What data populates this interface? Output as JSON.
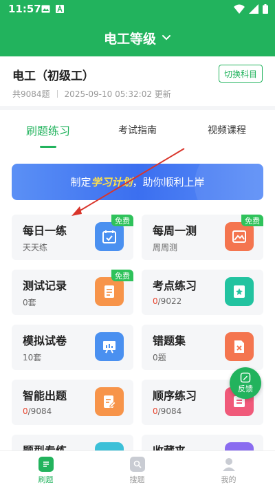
{
  "status_bar": {
    "time": "11:57",
    "icons": [
      "image-icon",
      "text-a-icon",
      "wifi-icon",
      "signal-icon",
      "battery-icon"
    ]
  },
  "header": {
    "title": "电工等级",
    "icon": "chevron-down-icon"
  },
  "subject": {
    "name": "电工（初级工）",
    "count": "共9084题",
    "updated": "2025-09-10 05:32:02 更新",
    "switch_label": "切换科目"
  },
  "tabs": [
    {
      "label": "刷题练习",
      "active": true
    },
    {
      "label": "考试指南"
    },
    {
      "label": "视频课程"
    }
  ],
  "banner": {
    "prefix": "制定",
    "highlight": "学习计划",
    "suffix": "，助你顺利上岸"
  },
  "free_label": "免费",
  "cards": [
    {
      "title": "每日一练",
      "sub": "天天练",
      "icon": "calendar-check-icon",
      "color": "#4a90f0"
    },
    {
      "title": "每周一测",
      "sub": "周周测",
      "icon": "picture-icon",
      "color": "#f4754f"
    },
    {
      "title": "测试记录",
      "sub": "0套",
      "icon": "document-icon",
      "color": "#f7944a"
    },
    {
      "title": "考点练习",
      "done": "0",
      "total": "/9022",
      "icon": "star-badge-icon",
      "color": "#22c3a0"
    },
    {
      "title": "模拟试卷",
      "sub": "10套",
      "icon": "chart-board-icon",
      "color": "#4a90f0"
    },
    {
      "title": "错题集",
      "sub": "0题",
      "icon": "error-file-icon",
      "color": "#f4754f"
    },
    {
      "title": "智能出题",
      "done": "0",
      "total": "/9084",
      "icon": "edit-document-icon",
      "color": "#f7944a"
    },
    {
      "title": "顺序练习",
      "done": "0",
      "total": "/9084",
      "icon": "numbered-list-icon",
      "color": "#f05a7a"
    },
    {
      "title": "题型专练",
      "icon": "category-icon",
      "color": "#3cc0d8"
    },
    {
      "title": "收藏夹",
      "icon": "bookmark-icon",
      "color": "#8a6cf0"
    }
  ],
  "feedback_label": "反馈",
  "bottom_nav": [
    {
      "label": "刷题",
      "active": true
    },
    {
      "label": "搜题"
    },
    {
      "label": "我的"
    }
  ],
  "colors": {
    "brand": "#22b35d",
    "accent_red": "#e8462f",
    "free_badge": "#2fc25b"
  }
}
